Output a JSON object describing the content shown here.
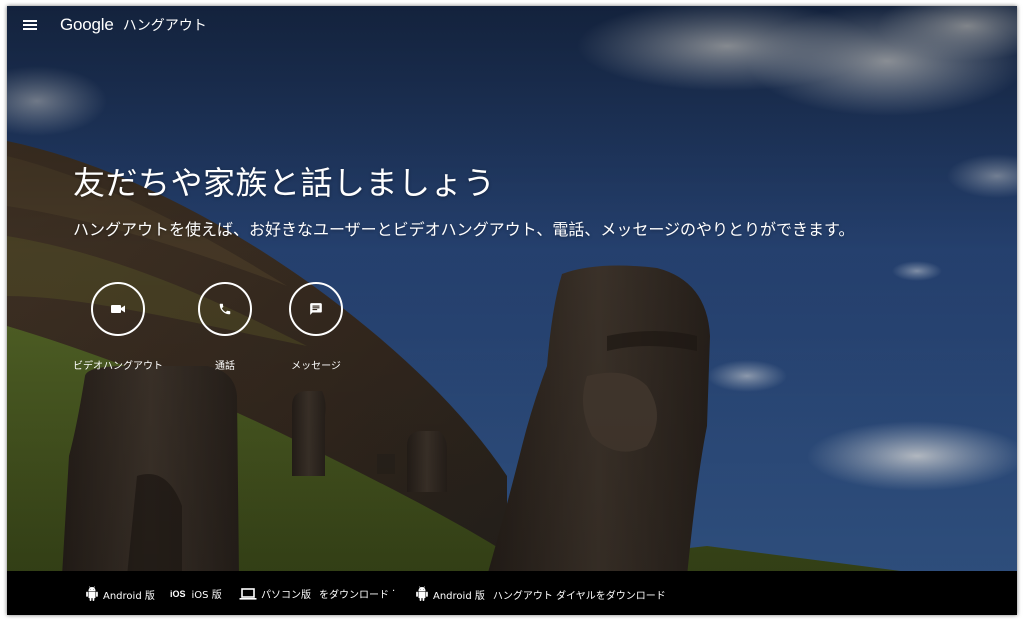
{
  "header": {
    "logo_text": "Google",
    "product_name": "ハングアウト",
    "menu_icon": "hamburger-menu-icon"
  },
  "hero": {
    "title": "友だちや家族と話しましょう",
    "subtitle": "ハングアウトを使えば、お好きなユーザーとビデオハングアウト、電話、メッセージのやりとりができます。"
  },
  "actions": [
    {
      "label": "ビデオハングアウト",
      "icon": "video-camera-icon"
    },
    {
      "label": "通話",
      "icon": "phone-icon"
    },
    {
      "label": "メッセージ",
      "icon": "message-icon"
    }
  ],
  "footer": {
    "android_label": "Android 版",
    "ios_mark": "iOS",
    "ios_label": "iOS 版",
    "pc_label": "パソコン版",
    "download_label": "をダウンロード",
    "separator": "·",
    "dialer_android_label": "Android 版",
    "dialer_label": "ハングアウト ダイヤルをダウンロード"
  },
  "colors": {
    "sky": "#2e4c7e",
    "footer_bg": "#000000",
    "text": "#ffffff"
  }
}
